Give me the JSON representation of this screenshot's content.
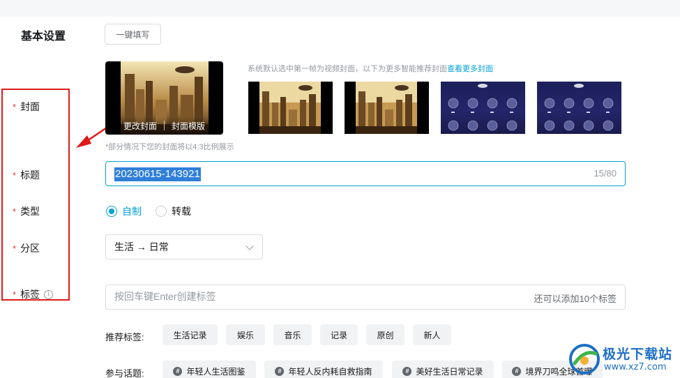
{
  "section": {
    "title": "基本设置",
    "onekey_label": "一键填写"
  },
  "labels": {
    "cover": "封面",
    "title": "标题",
    "type": "类型",
    "zone": "分区",
    "tags": "标签",
    "required_mark": "*",
    "info_glyph": "i"
  },
  "cover": {
    "change_label": "更改封面",
    "template_label": "封面模版",
    "hint_text": "系统默认选中第一帧为视频封面，以下为更多智能推荐封面",
    "hint_link": "查看更多封面",
    "ratio_note": "*部分情况下您的封面将以4:3比例展示",
    "thumbnails": [
      "city",
      "city",
      "night",
      "night"
    ]
  },
  "title_field": {
    "value": "20230615-143921",
    "count": "15/80"
  },
  "type_field": {
    "options": [
      "自制",
      "转载"
    ],
    "selected": "自制"
  },
  "zone_field": {
    "value": "生活 → 日常"
  },
  "tags_field": {
    "placeholder": "按回车键Enter创建标签",
    "remaining": "还可以添加10个标签"
  },
  "recommended_tags": {
    "label": "推荐标签:",
    "items": [
      "生活记录",
      "娱乐",
      "音乐",
      "记录",
      "原创",
      "新人"
    ]
  },
  "topics": {
    "label": "参与话题:",
    "items": [
      "年轻人生活图鉴",
      "年轻人反内耗自救指南",
      "美好生活日常记录",
      "境界刀鸣全球首曝"
    ]
  },
  "watermark": {
    "name": "极光下载站",
    "url": "www.xz7.com"
  },
  "colors": {
    "accent": "#00a1d6",
    "required": "#e23c3c",
    "annotation": "#e01919",
    "selection": "#2f7fd9"
  }
}
